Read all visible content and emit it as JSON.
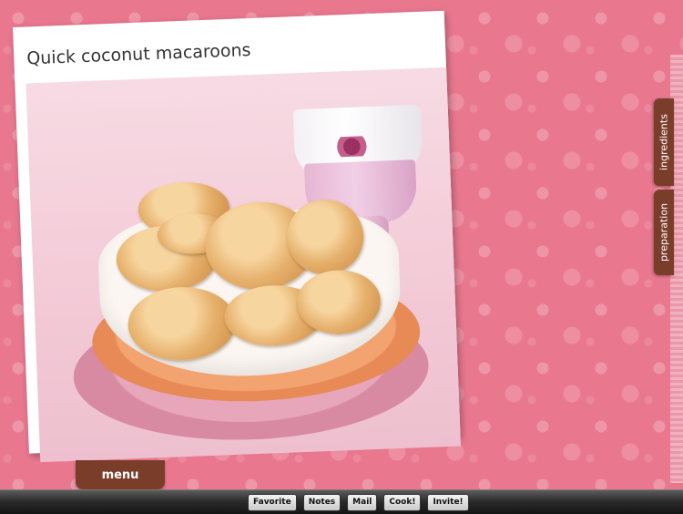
{
  "recipe": {
    "title": "Quick coconut macaroons"
  },
  "side_tabs": {
    "ingredients": "ingredients",
    "preparation": "preparation"
  },
  "menu": {
    "label": "menu"
  },
  "toolbar": {
    "favorite": "Favorite",
    "notes": "Notes",
    "mail": "Mail",
    "cook": "Cook!",
    "invite": "Invite!"
  },
  "colors": {
    "background_pink": "#e9788f",
    "tab_brown": "#7a3d2a",
    "toolbar_dark": "#2d2d2d"
  }
}
